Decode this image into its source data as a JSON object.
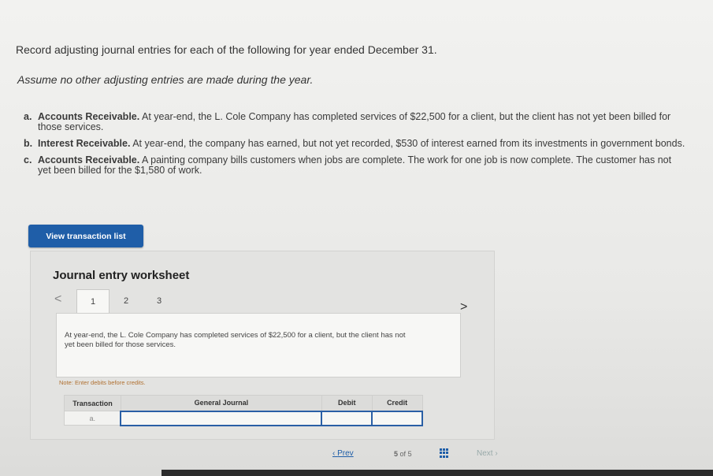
{
  "instructions": {
    "intro": "Record adjusting journal entries for each of the following for year ended December 31.",
    "assume": "Assume no other adjusting entries are made during the year."
  },
  "items": [
    {
      "letter": "a.",
      "heading": "Accounts Receivable.",
      "text": " At year-end, the L. Cole Company has completed services of $22,500 for a client, but the client has not yet been billed for those services."
    },
    {
      "letter": "b.",
      "heading": "Interest Receivable.",
      "text": " At year-end, the company has earned, but not yet recorded, $530 of interest earned from its investments in government bonds."
    },
    {
      "letter": "c.",
      "heading": "Accounts Receivable.",
      "text": " A painting company bills customers when jobs are complete. The work for one job is now complete. The customer has not yet been billed for the $1,580 of work."
    }
  ],
  "view_button": "View transaction list",
  "worksheet": {
    "title": "Journal entry worksheet",
    "prev": "<",
    "next": ">",
    "tabs": [
      "1",
      "2",
      "3"
    ],
    "active_tab": "1",
    "description": "At year-end, the L. Cole Company has completed services of $22,500 for a client, but the client has not yet been billed for those services.",
    "note": "Note: Enter debits before credits.",
    "columns": [
      "Transaction",
      "General Journal",
      "Debit",
      "Credit"
    ],
    "rows": [
      {
        "transaction": "a.",
        "account": "",
        "debit": "",
        "credit": ""
      }
    ]
  },
  "pager": {
    "prev": "Prev",
    "current": "5",
    "of": "of",
    "total": "5",
    "next": "Next"
  }
}
